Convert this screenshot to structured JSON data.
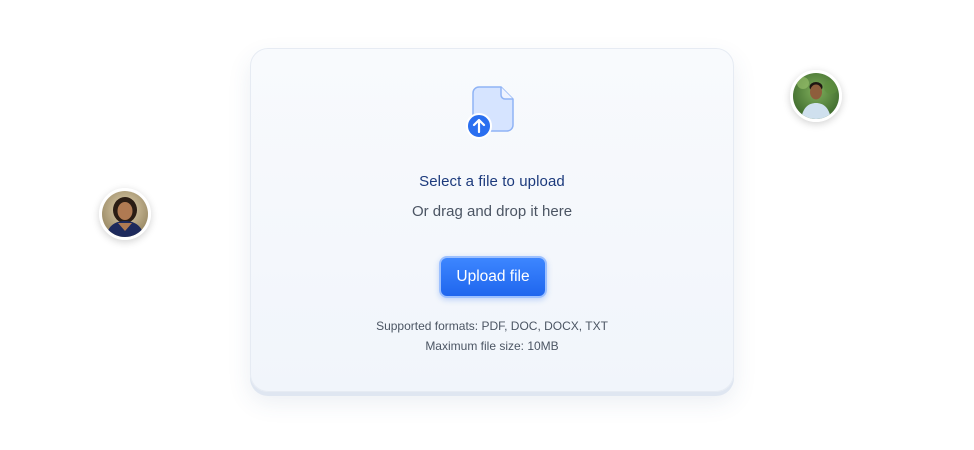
{
  "upload": {
    "title": "Select a file to upload",
    "subtitle": "Or drag and drop it here",
    "button_label": "Upload file",
    "supported_formats": "Supported formats: PDF, DOC, DOCX, TXT",
    "max_size": "Maximum file size: 10MB",
    "icon": "file-upload-icon"
  },
  "avatars": {
    "left": {
      "icon": "avatar-woman"
    },
    "right": {
      "icon": "avatar-man"
    }
  },
  "colors": {
    "accent": "#1f66ee",
    "title": "#1c3a7c",
    "text": "#4b5563",
    "card_bg": "#f4f7fc"
  }
}
